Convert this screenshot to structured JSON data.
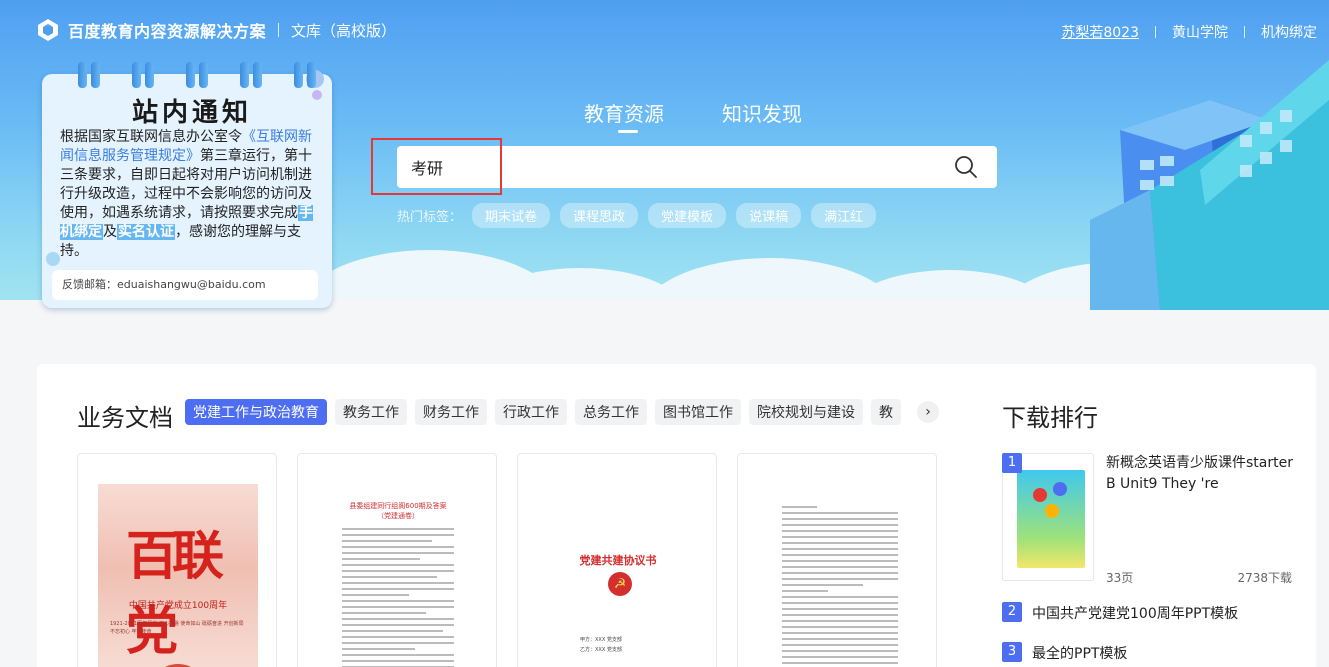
{
  "header": {
    "brand": "百度教育内容资源解决方案",
    "product": "文库（高校版）",
    "user_name": "苏梨若8023",
    "school": "黄山学院",
    "org_bind": "机构绑定"
  },
  "notice": {
    "title": "站内通知",
    "p1": "根据国家互联网信息办公室令",
    "link": "《互联网新闻信息服务管理规定》",
    "p2": "第三章运行，第十三条要求，自即日起将对用户访问机制进行升级改造，过程中不会影响您的访问及使用，如遇系统请求，请按照要求完成",
    "hl1": "手机绑定",
    "mid": "及",
    "hl2": "实名认证",
    "p3": "，感谢您的理解与支持。",
    "feedback": "反馈邮箱：eduaishangwu@baidu.com"
  },
  "search": {
    "tabs": [
      {
        "label": "教育资源",
        "active": true
      },
      {
        "label": "知识发现",
        "active": false
      }
    ],
    "value": "考研",
    "hot_label": "热门标签：",
    "hot_tags": [
      "期末试卷",
      "课程思政",
      "党建模板",
      "说课稿",
      "满江红"
    ]
  },
  "business_docs": {
    "title": "业务文档",
    "categories": [
      "党建工作与政治教育",
      "教务工作",
      "财务工作",
      "行政工作",
      "总务工作",
      "图书馆工作",
      "院校规划与建设",
      "教"
    ],
    "active_index": 0,
    "next_icon": "chevron-right-icon",
    "docs": {
      "d1_big": "百联党",
      "d1_sub": "中国共产党成立100周年",
      "d1_tiny": "1921-2021百年风华 初心如磐 使命如山 砥砺奋进 开创新局 不忘初心 牢记使命",
      "d2_head": "县委组建同行组阁600期及答案",
      "d2_head2": "（党建通卷）",
      "d3_title": "党建共建协议书",
      "d3_emblem": "☭",
      "d3_sig1": "甲方：XXX 党支部",
      "d3_sig2": "乙方：XXX 党支部"
    }
  },
  "ranking": {
    "title": "下载排行",
    "items": [
      {
        "rank": "1",
        "title": "新概念英语青少版课件starter B Unit9 They 're",
        "pages": "33页",
        "downloads": "2738下载"
      },
      {
        "rank": "2",
        "title": "中国共产党建党100周年PPT模板"
      },
      {
        "rank": "3",
        "title": "最全的PPT模板"
      }
    ]
  },
  "colors": {
    "accent": "#4e6ef2",
    "highlight_box": "#e53935",
    "hero_top": "#4f9ff1"
  }
}
